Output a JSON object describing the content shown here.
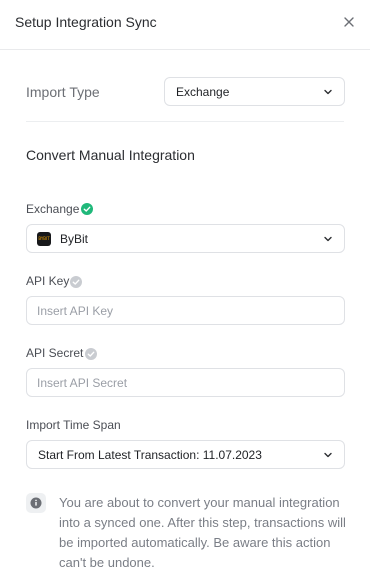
{
  "header": {
    "title": "Setup Integration Sync",
    "close_icon": "close-icon"
  },
  "import_type": {
    "label": "Import Type",
    "value": "Exchange"
  },
  "section": {
    "title": "Convert Manual Integration"
  },
  "exchange": {
    "label": "Exchange",
    "status": "verified",
    "status_color": "#1fb87a",
    "value": "ByBit",
    "logo_text": "BYBIT"
  },
  "api_key": {
    "label": "API Key",
    "status": "unverified",
    "placeholder": "Insert API Key",
    "value": ""
  },
  "api_secret": {
    "label": "API Secret",
    "status": "unverified",
    "placeholder": "Insert API Secret",
    "value": ""
  },
  "time_span": {
    "label": "Import Time Span",
    "value": "Start From Latest Transaction: 11.07.2023"
  },
  "notice": {
    "icon": "info-icon",
    "text": "You are about to convert your manual integration into a synced one. After this step, transactions will be imported automatically. Be aware this action can't be undone."
  },
  "colors": {
    "check_inactive": "#c9ccd1",
    "border": "#dfe1e5",
    "text_muted": "#7a7e86"
  }
}
